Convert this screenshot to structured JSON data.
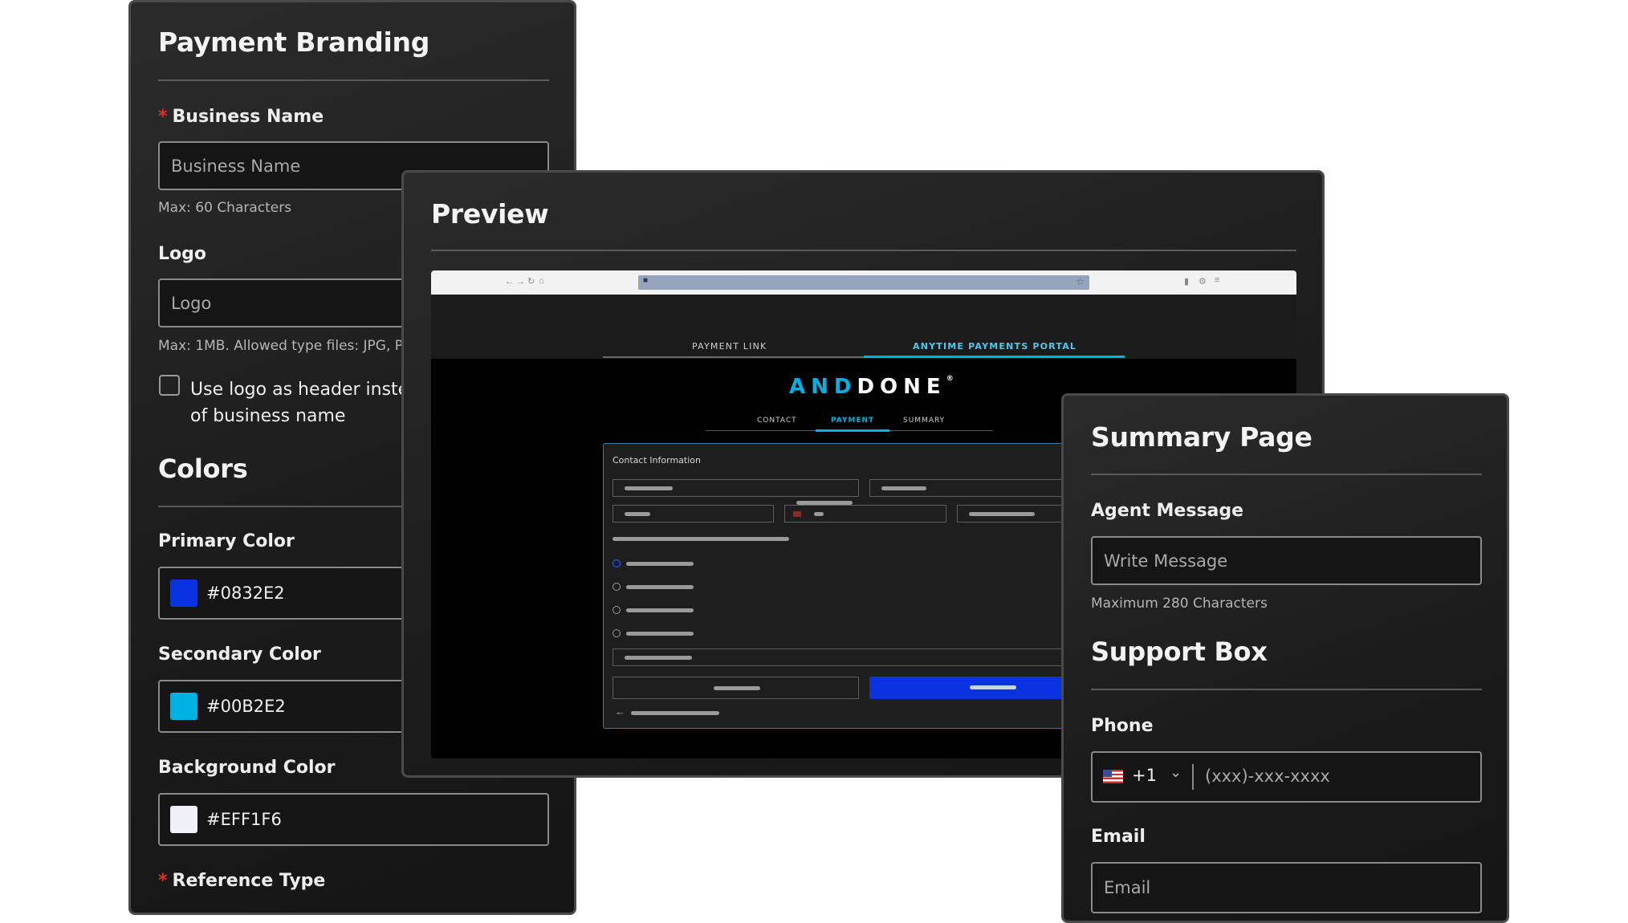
{
  "branding": {
    "title": "Payment Branding",
    "business_name": {
      "label": "Business Name",
      "placeholder": "Business Name",
      "hint": "Max: 60 Characters"
    },
    "logo": {
      "label": "Logo",
      "placeholder": "Logo",
      "hint": "Max: 1MB. Allowed type files: JPG, P"
    },
    "use_logo_checkbox": {
      "label": "Use logo as header instead of business name"
    },
    "colors_heading": "Colors",
    "primary_color": {
      "label": "Primary Color",
      "value": "#0832E2"
    },
    "secondary_color": {
      "label": "Secondary Color",
      "value": "#00B2E2"
    },
    "background_color": {
      "label": "Background Color",
      "value": "#EFF1F6"
    },
    "reference_type": {
      "label": "Reference Type"
    }
  },
  "preview": {
    "title": "Preview",
    "tabs": [
      "PAYMENT LINK",
      "ANYTIME PAYMENTS PORTAL"
    ],
    "active_tab": 1,
    "brand": {
      "part1": "AND",
      "part2": "DONE",
      "mark": "®"
    },
    "steps": [
      "CONTACT",
      "PAYMENT",
      "SUMMARY"
    ],
    "active_step": 1,
    "form_title": "Contact Information",
    "browser_icons": [
      "back-icon",
      "forward-icon",
      "reload-icon",
      "home-icon",
      "lock-icon",
      "star-icon",
      "bookmark-icon",
      "settings-icon",
      "menu-icon"
    ]
  },
  "summary": {
    "title": "Summary Page",
    "agent_message": {
      "label": "Agent Message",
      "placeholder": "Write Message",
      "hint": "Maximum 280 Characters"
    },
    "support_box_heading": "Support Box",
    "phone": {
      "label": "Phone",
      "country_code": "+1",
      "placeholder": "(xxx)-xxx-xxxx"
    },
    "email": {
      "label": "Email",
      "placeholder": "Email"
    }
  },
  "colors": {
    "primary": "#0832E2",
    "secondary": "#00B2E2",
    "background": "#EFF1F6",
    "required": "#D8342A"
  }
}
